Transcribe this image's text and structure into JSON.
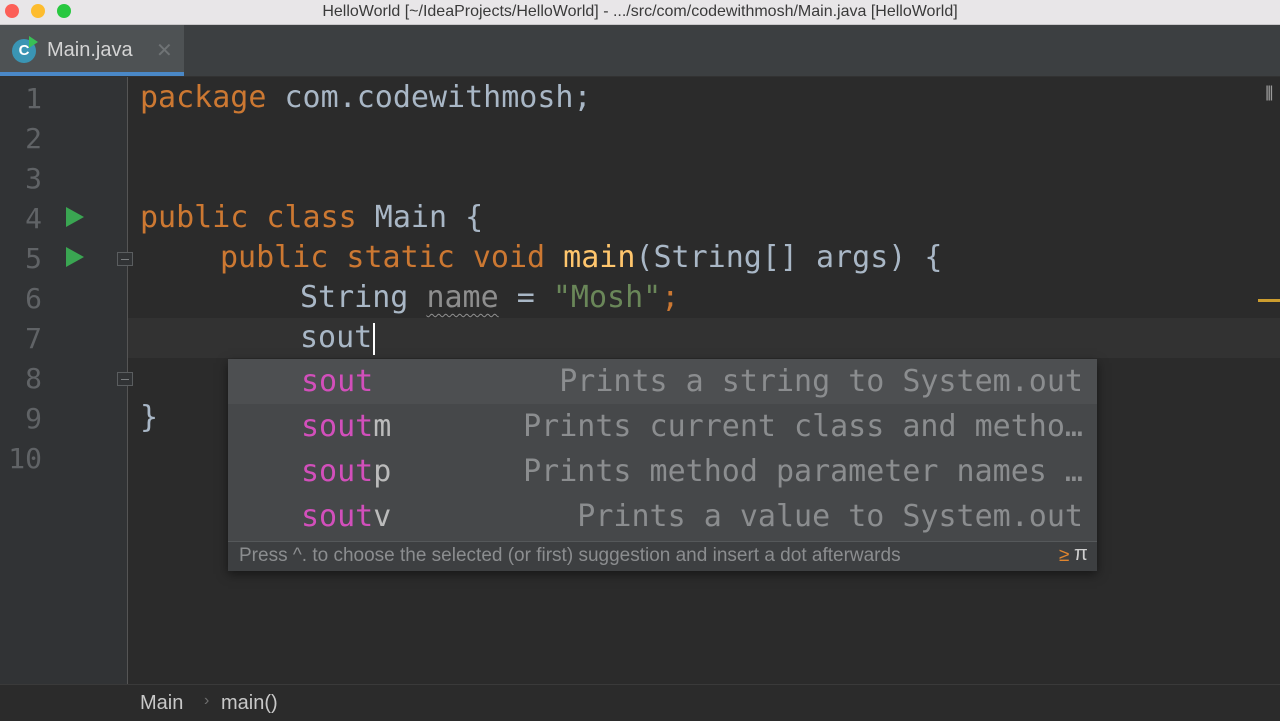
{
  "window": {
    "title": "HelloWorld [~/IdeaProjects/HelloWorld] - .../src/com/codewithmosh/Main.java [HelloWorld]"
  },
  "tab": {
    "label": "Main.java",
    "icon_letter": "C",
    "close_glyph": "✕"
  },
  "line_numbers": [
    "1",
    "2",
    "3",
    "4",
    "5",
    "6",
    "7",
    "8",
    "9",
    "10"
  ],
  "code": {
    "line1": {
      "kw": "package",
      "rest": " com.codewithmosh;"
    },
    "line4": {
      "kw": "public class",
      "rest": " Main {"
    },
    "line5": {
      "kw1": "public static void",
      "fn": "main",
      "rest": "(String[] args) {"
    },
    "line6": {
      "type": "String",
      "var": "name",
      "eq": " = ",
      "str": "\"Mosh\"",
      "semi": ";"
    },
    "line7": {
      "typed": "sout"
    },
    "line9": {
      "brace": "}"
    }
  },
  "completion": {
    "items": [
      {
        "match": "sout",
        "suffix": "",
        "desc": "Prints a string to System.out"
      },
      {
        "match": "sout",
        "suffix": "m",
        "desc": "Prints current class and metho…"
      },
      {
        "match": "sout",
        "suffix": "p",
        "desc": "Prints method parameter names …"
      },
      {
        "match": "sout",
        "suffix": "v",
        "desc": "Prints a value to System.out"
      }
    ],
    "footer_hint": "Press ^. to choose the selected (or first) suggestion and insert a dot afterwards",
    "footer_more": "≥",
    "footer_pi": "π"
  },
  "breadcrumb": {
    "class": "Main",
    "separator": "›",
    "method": "main()"
  },
  "colors": {
    "keyword": "#cc7832",
    "function": "#ffc66d",
    "string": "#6a8759",
    "match_highlight": "#d24fbb",
    "run_icon": "#3aa652",
    "tab_underline": "#4a88c7"
  }
}
